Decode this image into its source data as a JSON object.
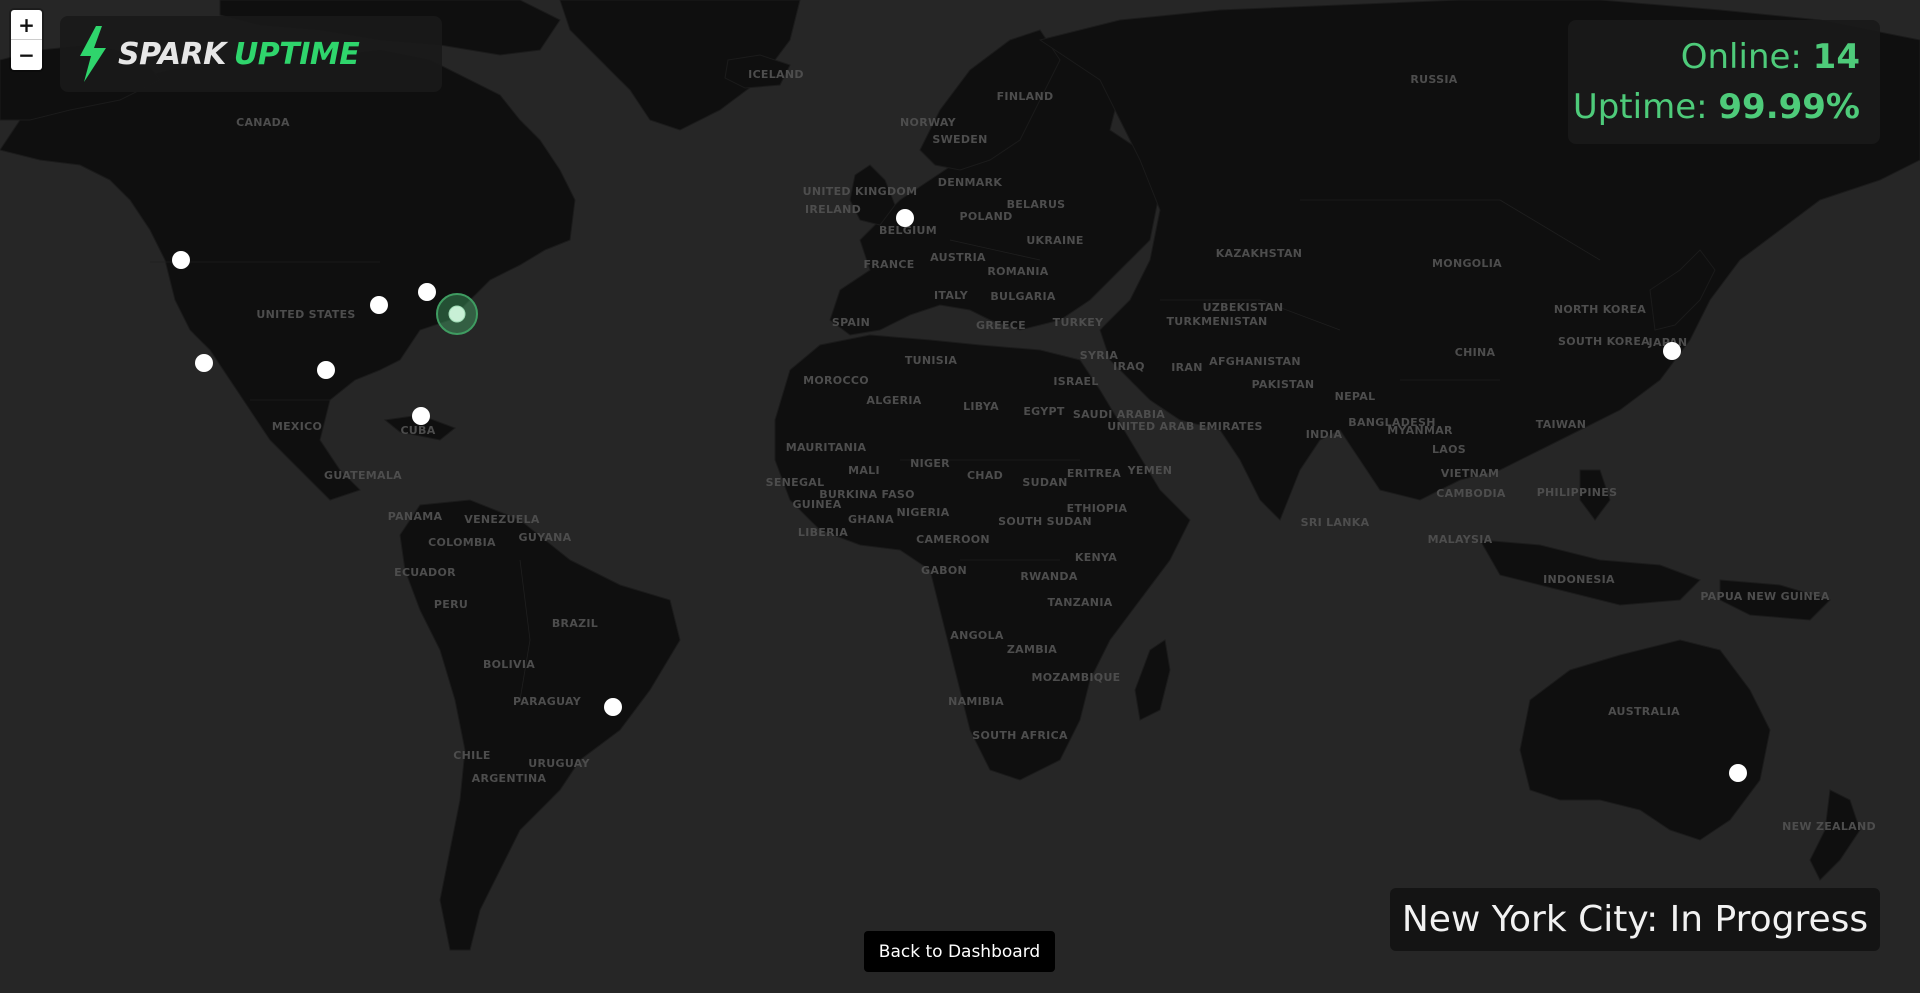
{
  "map": {
    "country_labels": [
      {
        "id": "canada",
        "text": "CANADA"
      },
      {
        "id": "united-states",
        "text": "UNITED STATES"
      },
      {
        "id": "mexico",
        "text": "MEXICO"
      },
      {
        "id": "cuba",
        "text": "CUBA"
      },
      {
        "id": "guatemala",
        "text": "GUATEMALA"
      },
      {
        "id": "panama",
        "text": "PANAMA"
      },
      {
        "id": "venezuela",
        "text": "VENEZUELA"
      },
      {
        "id": "colombia",
        "text": "COLOMBIA"
      },
      {
        "id": "guyana",
        "text": "GUYANA"
      },
      {
        "id": "ecuador",
        "text": "ECUADOR"
      },
      {
        "id": "peru",
        "text": "PERU"
      },
      {
        "id": "brazil",
        "text": "BRAZIL"
      },
      {
        "id": "bolivia",
        "text": "BOLIVIA"
      },
      {
        "id": "paraguay",
        "text": "PARAGUAY"
      },
      {
        "id": "chile",
        "text": "CHILE"
      },
      {
        "id": "uruguay",
        "text": "URUGUAY"
      },
      {
        "id": "argentina",
        "text": "ARGENTINA"
      },
      {
        "id": "iceland",
        "text": "ICELAND"
      },
      {
        "id": "ireland",
        "text": "IRELAND"
      },
      {
        "id": "united-kingdom",
        "text": "UNITED KINGDOM"
      },
      {
        "id": "norway",
        "text": "NORWAY"
      },
      {
        "id": "sweden",
        "text": "SWEDEN"
      },
      {
        "id": "finland",
        "text": "FINLAND"
      },
      {
        "id": "denmark",
        "text": "DENMARK"
      },
      {
        "id": "belgium",
        "text": "BELGIUM"
      },
      {
        "id": "france",
        "text": "FRANCE"
      },
      {
        "id": "spain",
        "text": "SPAIN"
      },
      {
        "id": "italy",
        "text": "ITALY"
      },
      {
        "id": "austria",
        "text": "AUSTRIA"
      },
      {
        "id": "poland",
        "text": "POLAND"
      },
      {
        "id": "belarus",
        "text": "BELARUS"
      },
      {
        "id": "ukraine",
        "text": "UKRAINE"
      },
      {
        "id": "romania",
        "text": "ROMANIA"
      },
      {
        "id": "bulgaria",
        "text": "BULGARIA"
      },
      {
        "id": "greece",
        "text": "GREECE"
      },
      {
        "id": "turkey",
        "text": "TURKEY"
      },
      {
        "id": "russia",
        "text": "RUSSIA"
      },
      {
        "id": "kazakhstan",
        "text": "KAZAKHSTAN"
      },
      {
        "id": "uzbekistan",
        "text": "UZBEKISTAN"
      },
      {
        "id": "turkmenistan",
        "text": "TURKMENISTAN"
      },
      {
        "id": "mongolia",
        "text": "MONGOLIA"
      },
      {
        "id": "china",
        "text": "CHINA"
      },
      {
        "id": "north-korea",
        "text": "NORTH KOREA"
      },
      {
        "id": "south-korea",
        "text": "SOUTH KOREA"
      },
      {
        "id": "japan",
        "text": "JAPAN"
      },
      {
        "id": "syria",
        "text": "SYRIA"
      },
      {
        "id": "iraq",
        "text": "IRAQ"
      },
      {
        "id": "iran",
        "text": "IRAN"
      },
      {
        "id": "israel",
        "text": "ISRAEL"
      },
      {
        "id": "afghanistan",
        "text": "AFGHANISTAN"
      },
      {
        "id": "pakistan",
        "text": "PAKISTAN"
      },
      {
        "id": "nepal",
        "text": "NEPAL"
      },
      {
        "id": "india",
        "text": "INDIA"
      },
      {
        "id": "bangladesh",
        "text": "BANGLADESH"
      },
      {
        "id": "myanmar",
        "text": "MYANMAR"
      },
      {
        "id": "laos",
        "text": "LAOS"
      },
      {
        "id": "vietnam",
        "text": "VIETNAM"
      },
      {
        "id": "cambodia",
        "text": "CAMBODIA"
      },
      {
        "id": "taiwan",
        "text": "TAIWAN"
      },
      {
        "id": "philippines",
        "text": "PHILIPPINES"
      },
      {
        "id": "malaysia",
        "text": "MALAYSIA"
      },
      {
        "id": "indonesia",
        "text": "INDONESIA"
      },
      {
        "id": "sri-lanka",
        "text": "SRI LANKA"
      },
      {
        "id": "saudi-arabia",
        "text": "SAUDI ARABIA"
      },
      {
        "id": "uae",
        "text": "UNITED ARAB EMIRATES"
      },
      {
        "id": "yemen",
        "text": "YEMEN"
      },
      {
        "id": "morocco",
        "text": "MOROCCO"
      },
      {
        "id": "tunisia",
        "text": "TUNISIA"
      },
      {
        "id": "algeria",
        "text": "ALGERIA"
      },
      {
        "id": "libya",
        "text": "LIBYA"
      },
      {
        "id": "egypt",
        "text": "EGYPT"
      },
      {
        "id": "mauritania",
        "text": "MAURITANIA"
      },
      {
        "id": "mali",
        "text": "MALI"
      },
      {
        "id": "niger",
        "text": "NIGER"
      },
      {
        "id": "chad",
        "text": "CHAD"
      },
      {
        "id": "sudan",
        "text": "SUDAN"
      },
      {
        "id": "eritrea",
        "text": "ERITREA"
      },
      {
        "id": "senegal",
        "text": "SENEGAL"
      },
      {
        "id": "guinea",
        "text": "GUINEA"
      },
      {
        "id": "burkina-faso",
        "text": "BURKINA FASO"
      },
      {
        "id": "liberia",
        "text": "LIBERIA"
      },
      {
        "id": "ghana",
        "text": "GHANA"
      },
      {
        "id": "nigeria",
        "text": "NIGERIA"
      },
      {
        "id": "cameroon",
        "text": "CAMEROON"
      },
      {
        "id": "south-sudan",
        "text": "SOUTH SUDAN"
      },
      {
        "id": "ethiopia",
        "text": "ETHIOPIA"
      },
      {
        "id": "gabon",
        "text": "GABON"
      },
      {
        "id": "rwanda",
        "text": "RWANDA"
      },
      {
        "id": "kenya",
        "text": "KENYA"
      },
      {
        "id": "tanzania",
        "text": "TANZANIA"
      },
      {
        "id": "angola",
        "text": "ANGOLA"
      },
      {
        "id": "zambia",
        "text": "ZAMBIA"
      },
      {
        "id": "mozambique",
        "text": "MOZAMBIQUE"
      },
      {
        "id": "namibia",
        "text": "NAMIBIA"
      },
      {
        "id": "south-africa",
        "text": "SOUTH AFRICA"
      },
      {
        "id": "australia",
        "text": "AUSTRALIA"
      },
      {
        "id": "papua-new-guinea",
        "text": "PAPUA NEW GUINEA"
      },
      {
        "id": "new-zealand",
        "text": "NEW ZEALAND"
      }
    ],
    "colors": {
      "ocean": "#262626",
      "land": "#0f0f0f",
      "node": "#ffffff",
      "active": "#4ecb7a"
    }
  },
  "zoom": {
    "in_label": "+",
    "out_label": "−"
  },
  "logo": {
    "part1": "SPARK",
    "part2": "UPTIME",
    "accent": "#2fd56c",
    "icon": "lightning-bolt-icon"
  },
  "stats": {
    "online_label": "Online: ",
    "online_value": "14",
    "uptime_label": "Uptime: ",
    "uptime_value": "99.99%"
  },
  "status": {
    "text": "New York City: In Progress"
  },
  "back_button": {
    "label": "Back to Dashboard"
  }
}
